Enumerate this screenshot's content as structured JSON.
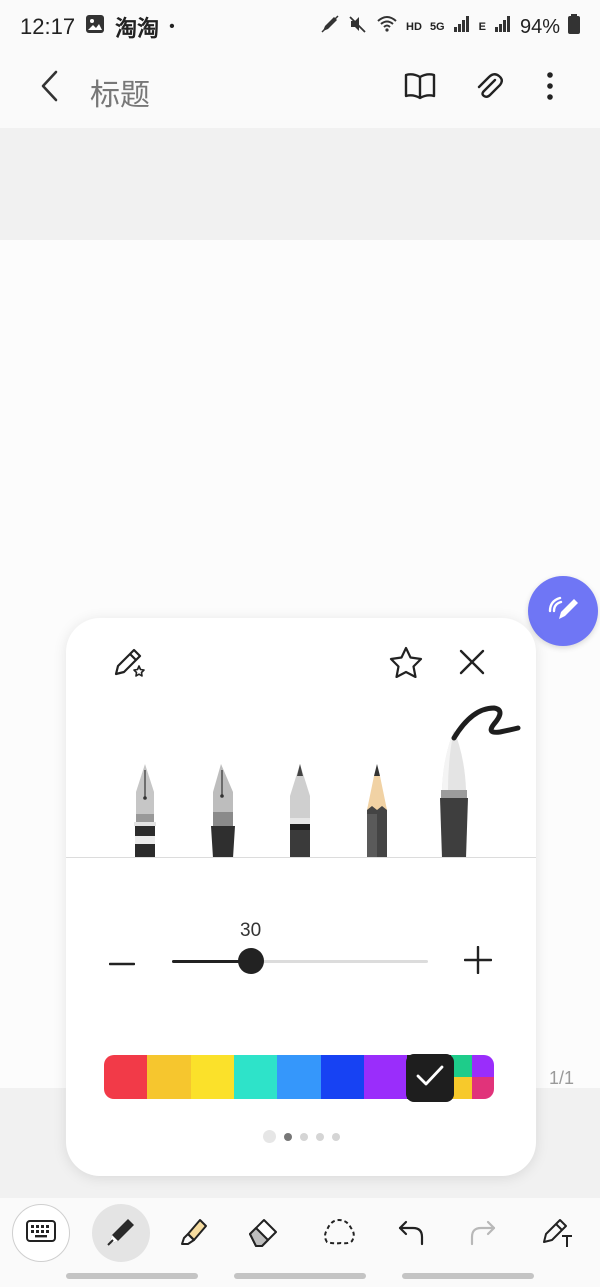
{
  "status_bar": {
    "time": "12:17",
    "app_label": "淘淘",
    "dot": "•",
    "network_hd": "HD",
    "network_5g": "5G",
    "network_e": "E",
    "battery": "94%"
  },
  "app_bar": {
    "title": "标题",
    "icons": [
      "chevron-left-icon",
      "book-icon",
      "paperclip-icon",
      "more-vertical-icon"
    ]
  },
  "canvas": {
    "page_indicator": "1/1"
  },
  "pen_panel": {
    "pen_types": [
      "fountain-pen",
      "calligraphy-pen",
      "ballpoint-pen",
      "pencil",
      "brush-pen"
    ],
    "selected_pen": "brush-pen",
    "size_value": "30",
    "size_level": 0.31,
    "colors": [
      "#f23a48",
      "#f6c62e",
      "#fbe12a",
      "#2ee3c9",
      "#3597fb",
      "#1742f3",
      "#9a2dfb"
    ],
    "selected_color_index": 7,
    "multicolor_swatch": [
      "#1ecc8a",
      "#9a2dfb",
      "#f7c92b",
      "#e1337a"
    ],
    "pages": 4,
    "active_page": 1,
    "colors_accent": "#6f76f5"
  },
  "toolbar": {
    "tools": [
      "keyboard-icon",
      "pen-icon",
      "highlighter-icon",
      "eraser-icon",
      "lasso-icon",
      "undo-icon",
      "redo-icon",
      "pen-text-icon"
    ],
    "active_tool": "pen-icon"
  }
}
